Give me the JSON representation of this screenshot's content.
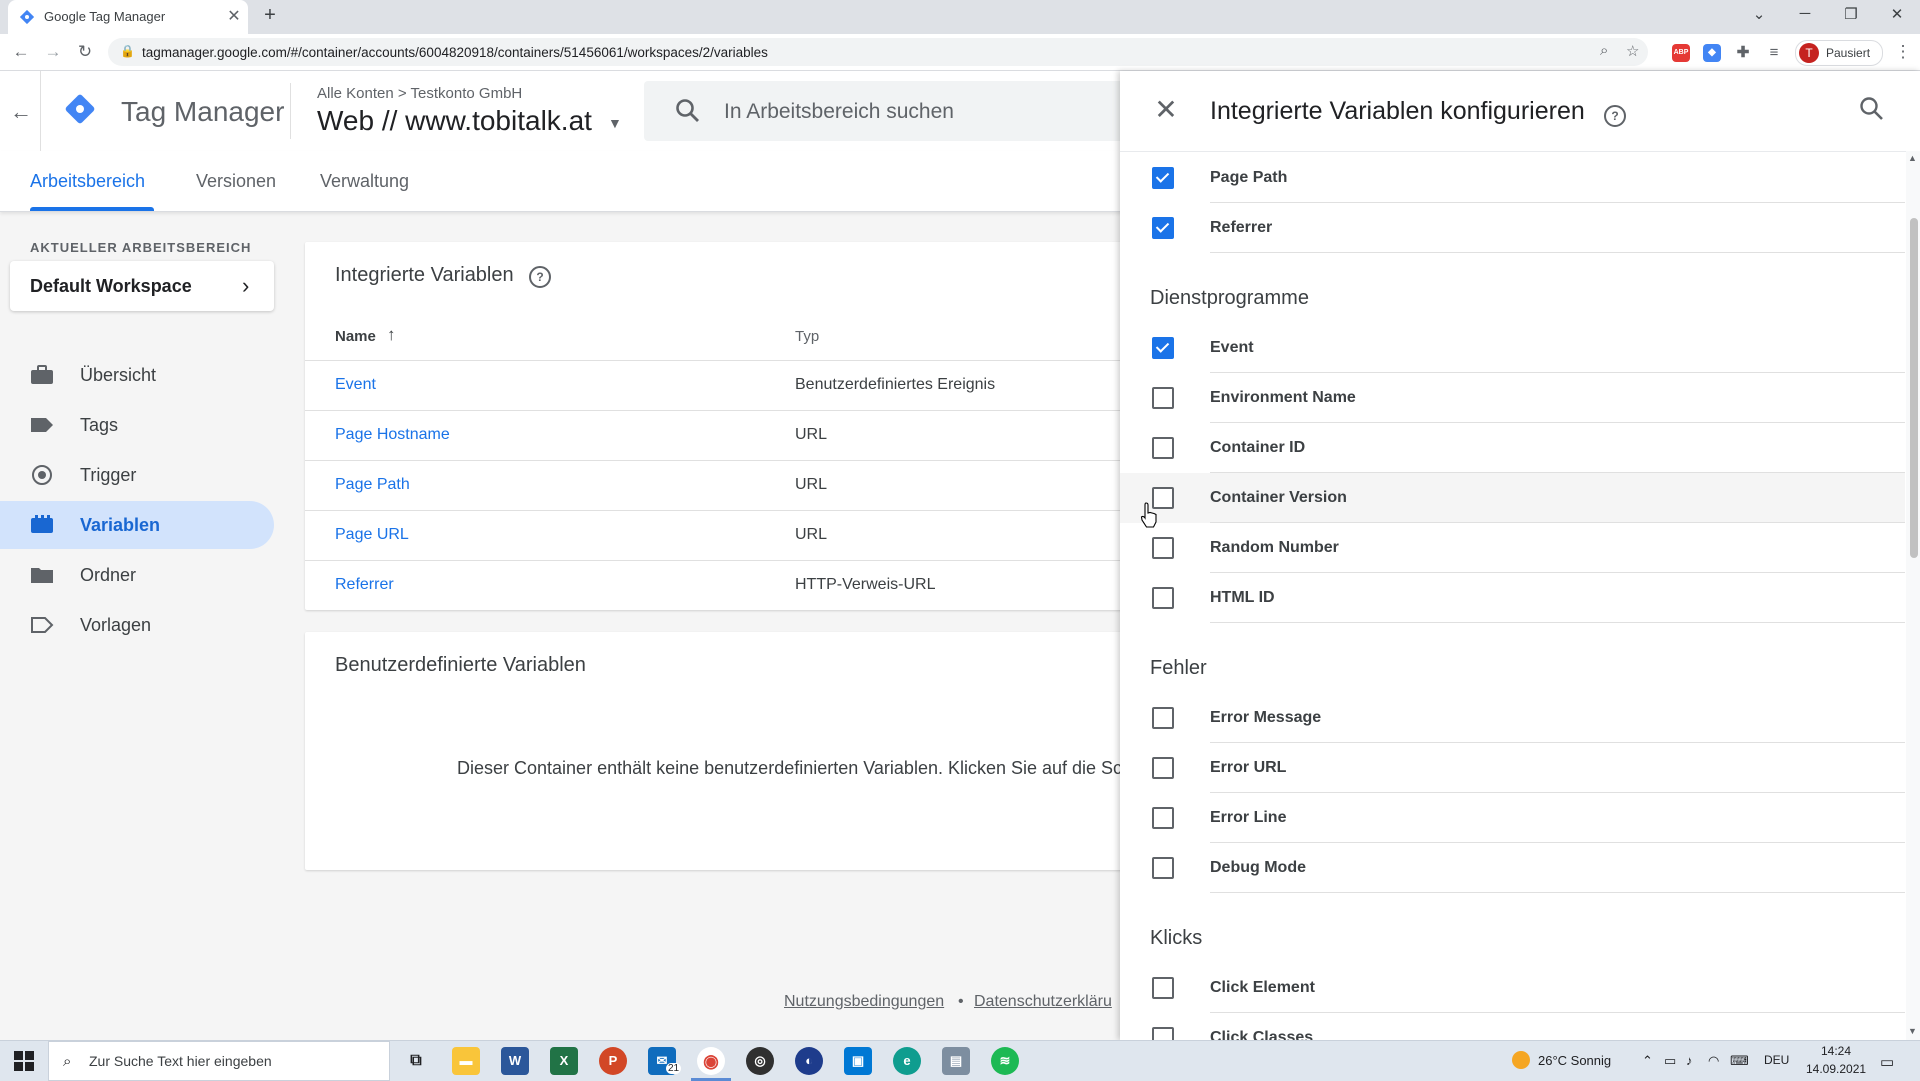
{
  "browser": {
    "tab_title": "Google Tag Manager",
    "tab_close": "✕",
    "new_tab": "+",
    "url": "tagmanager.google.com/#/container/accounts/6004820918/containers/51456061/workspaces/2/variables",
    "profile_initial": "T",
    "profile_status": "Pausiert",
    "ext_abp": "ABP"
  },
  "header": {
    "app_name": "Tag Manager",
    "breadcrumb": "Alle Konten  >  Testkonto GmbH",
    "container_name": "Web // www.tobitalk.at",
    "search_placeholder": "In Arbeitsbereich suchen"
  },
  "nav_tabs": [
    {
      "label": "Arbeitsbereich",
      "active": true
    },
    {
      "label": "Versionen",
      "active": false
    },
    {
      "label": "Verwaltung",
      "active": false
    }
  ],
  "sidebar": {
    "workspace_label": "AKTUELLER ARBEITSBEREICH",
    "workspace_name": "Default Workspace",
    "items": [
      {
        "label": "Übersicht",
        "icon": "briefcase-icon",
        "active": false
      },
      {
        "label": "Tags",
        "icon": "tag-icon",
        "active": false
      },
      {
        "label": "Trigger",
        "icon": "trigger-icon",
        "active": false
      },
      {
        "label": "Variablen",
        "icon": "variables-icon",
        "active": true
      },
      {
        "label": "Ordner",
        "icon": "folder-icon",
        "active": false
      },
      {
        "label": "Vorlagen",
        "icon": "template-icon",
        "active": false
      }
    ]
  },
  "builtin_card": {
    "title": "Integrierte Variablen",
    "help": "?",
    "col_name": "Name",
    "col_type": "Typ",
    "rows": [
      {
        "name": "Event",
        "type": "Benutzerdefiniertes Ereignis"
      },
      {
        "name": "Page Hostname",
        "type": "URL"
      },
      {
        "name": "Page Path",
        "type": "URL"
      },
      {
        "name": "Page URL",
        "type": "URL"
      },
      {
        "name": "Referrer",
        "type": "HTTP-Verweis-URL"
      }
    ]
  },
  "custom_card": {
    "title": "Benutzerdefinierte Variablen",
    "empty_text": "Dieser Container enthält keine benutzerdefinierten Variablen. Klicken Sie auf die Schalt"
  },
  "footer": {
    "terms": "Nutzungsbedingungen",
    "separator": "•",
    "privacy": "Datenschutzerkläru"
  },
  "panel": {
    "title": "Integrierte Variablen konfigurieren",
    "help": "?",
    "close": "✕",
    "sections": [
      {
        "title": "",
        "items": [
          {
            "label": "Page Path",
            "checked": true
          },
          {
            "label": "Referrer",
            "checked": true
          }
        ]
      },
      {
        "title": "Dienstprogramme",
        "items": [
          {
            "label": "Event",
            "checked": true
          },
          {
            "label": "Environment Name",
            "checked": false
          },
          {
            "label": "Container ID",
            "checked": false
          },
          {
            "label": "Container Version",
            "checked": false
          },
          {
            "label": "Random Number",
            "checked": false
          },
          {
            "label": "HTML ID",
            "checked": false
          }
        ]
      },
      {
        "title": "Fehler",
        "items": [
          {
            "label": "Error Message",
            "checked": false
          },
          {
            "label": "Error URL",
            "checked": false
          },
          {
            "label": "Error Line",
            "checked": false
          },
          {
            "label": "Debug Mode",
            "checked": false
          }
        ]
      },
      {
        "title": "Klicks",
        "items": [
          {
            "label": "Click Element",
            "checked": false
          },
          {
            "label": "Click Classes",
            "checked": false
          }
        ]
      }
    ]
  },
  "taskbar": {
    "search_placeholder": "Zur Suche Text hier eingeben",
    "mail_badge": "21",
    "weather": "26°C  Sonnig",
    "language": "DEU",
    "time": "14:24",
    "date": "14.09.2021"
  },
  "colors": {
    "accent": "#1a73e8",
    "active_nav_bg": "#d2e3fc"
  }
}
